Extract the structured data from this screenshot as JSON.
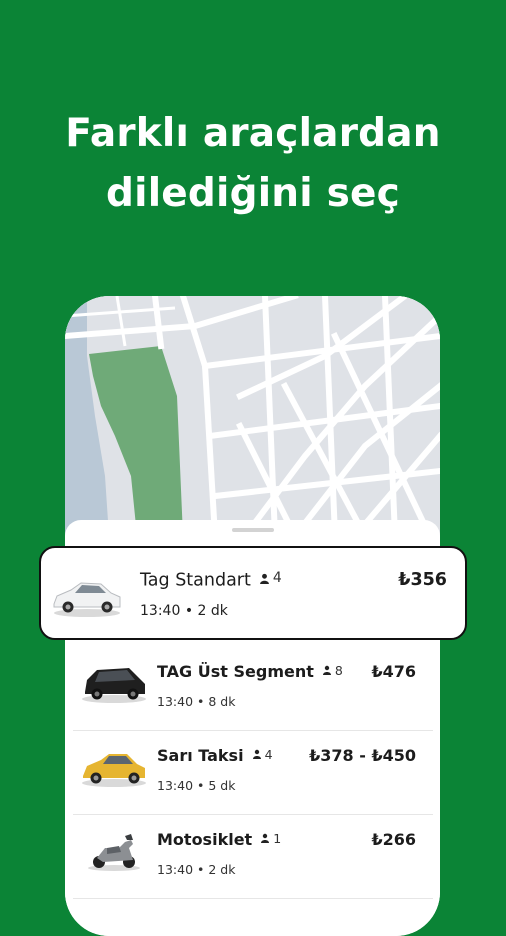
{
  "headline": {
    "line1": "Farklı araçlardan",
    "line2": "dilediğini seç"
  },
  "colors": {
    "background": "#0b8436",
    "map_park": "#6faa78",
    "map_water": "#b9c8d6"
  },
  "vehicles": [
    {
      "name": "Tag Standart",
      "capacity": "4",
      "time": "13:40",
      "eta": "2 dk",
      "price": "₺356",
      "icon": "white-sedan-icon",
      "selected": true
    },
    {
      "name": "TAG Üst Segment",
      "capacity": "8",
      "time": "13:40",
      "eta": "8 dk",
      "price": "₺476",
      "icon": "black-suv-icon",
      "selected": false
    },
    {
      "name": "Sarı Taksi",
      "capacity": "4",
      "time": "13:40",
      "eta": "5 dk",
      "price": "₺378 - ₺450",
      "icon": "yellow-taxi-icon",
      "selected": false
    },
    {
      "name": "Motosiklet",
      "capacity": "1",
      "time": "13:40",
      "eta": "2 dk",
      "price": "₺266",
      "icon": "scooter-icon",
      "selected": false
    }
  ],
  "separator": "•"
}
